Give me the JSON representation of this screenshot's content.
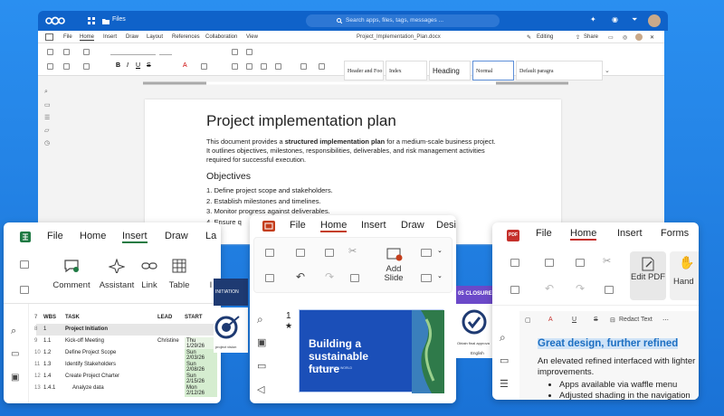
{
  "nextcloud": {
    "app": "Files",
    "search_placeholder": "Search apps, files, tags, messages ..."
  },
  "doc": {
    "menu": [
      "File",
      "Home",
      "Insert",
      "Draw",
      "Layout",
      "References",
      "Collaboration",
      "View"
    ],
    "filename": "Project_Implementation_Plan.docx",
    "editing": "Editing",
    "share": "Share",
    "styles": [
      "Header and Foo",
      "Index",
      "Heading",
      "Normal",
      "Default paragra"
    ],
    "page": {
      "title": "Project implementation plan",
      "body_pre": "This document provides a ",
      "body_bold": "structured implementation plan",
      "body_post": " for a medium-scale business project. It outlines objectives, milestones, responsibilities, deliverables, and risk management activities required for successful execution.",
      "heading": "Objectives",
      "items": [
        "1.  Define project scope and stakeholders.",
        "2.  Establish milestones and timelines.",
        "3.  Monitor progress against deliverables.",
        "4.  Ensure q"
      ]
    }
  },
  "sheet": {
    "tabs": [
      "File",
      "Home",
      "Insert",
      "Draw",
      "La"
    ],
    "ribbon": [
      "Comment",
      "Assistant",
      "Link",
      "Table",
      "I"
    ],
    "headers": [
      "WBS",
      "TASK",
      "LEAD",
      "START"
    ],
    "rows": [
      {
        "num": "7",
        "wbs": "WBS",
        "task": "TASK",
        "lead": "LEAD",
        "start": "START"
      },
      {
        "num": "8",
        "wbs": "1",
        "task": "Project Initiation",
        "lead": "",
        "start": ""
      },
      {
        "num": "9",
        "wbs": "1.1",
        "task": "Kick-off Meeting",
        "lead": "Christine",
        "start": "Thu 1/29/26"
      },
      {
        "num": "10",
        "wbs": "1.2",
        "task": "Define Project Scope",
        "lead": "",
        "start": "Sun 2/03/26"
      },
      {
        "num": "11",
        "wbs": "1.3",
        "task": "Identify Stakeholders",
        "lead": "",
        "start": "Sun 2/08/26"
      },
      {
        "num": "12",
        "wbs": "1.4",
        "task": "Create Project Charter",
        "lead": "",
        "start": "Sun 2/15/26"
      },
      {
        "num": "13",
        "wbs": "1.4.1",
        "task": "Analyze data",
        "lead": "",
        "start": "Mon 2/12/26"
      }
    ],
    "banner": "INITIATION"
  },
  "slides": {
    "tabs": [
      "File",
      "Home",
      "Insert",
      "Draw",
      "Desi"
    ],
    "add_slide": "Add\nSlide",
    "slide_num": "1",
    "thumb_title": "Building a sustainable future",
    "thumb_sub": "VISION OF A GREEN WORLD",
    "banner": "05 CLOSURE",
    "approve": "Obtain final approva",
    "english": "English"
  },
  "pdf": {
    "tabs": [
      "File",
      "Home",
      "Insert",
      "Forms"
    ],
    "ribbon": [
      "Edit PDF",
      "Hand"
    ],
    "redact": "Redact Text",
    "heading": "Great design, further refined",
    "body": "An elevated refined interfaced with lighter improvements.",
    "bullets": [
      "Apps available via waffle menu",
      "Adjusted shading in the navigation"
    ]
  },
  "colors": {
    "nc_blue": "#0f62c9",
    "sheet_green": "#1f7a43",
    "slides_red": "#c43e1c",
    "pdf_red": "#c5302b",
    "navy": "#1e3a72"
  }
}
